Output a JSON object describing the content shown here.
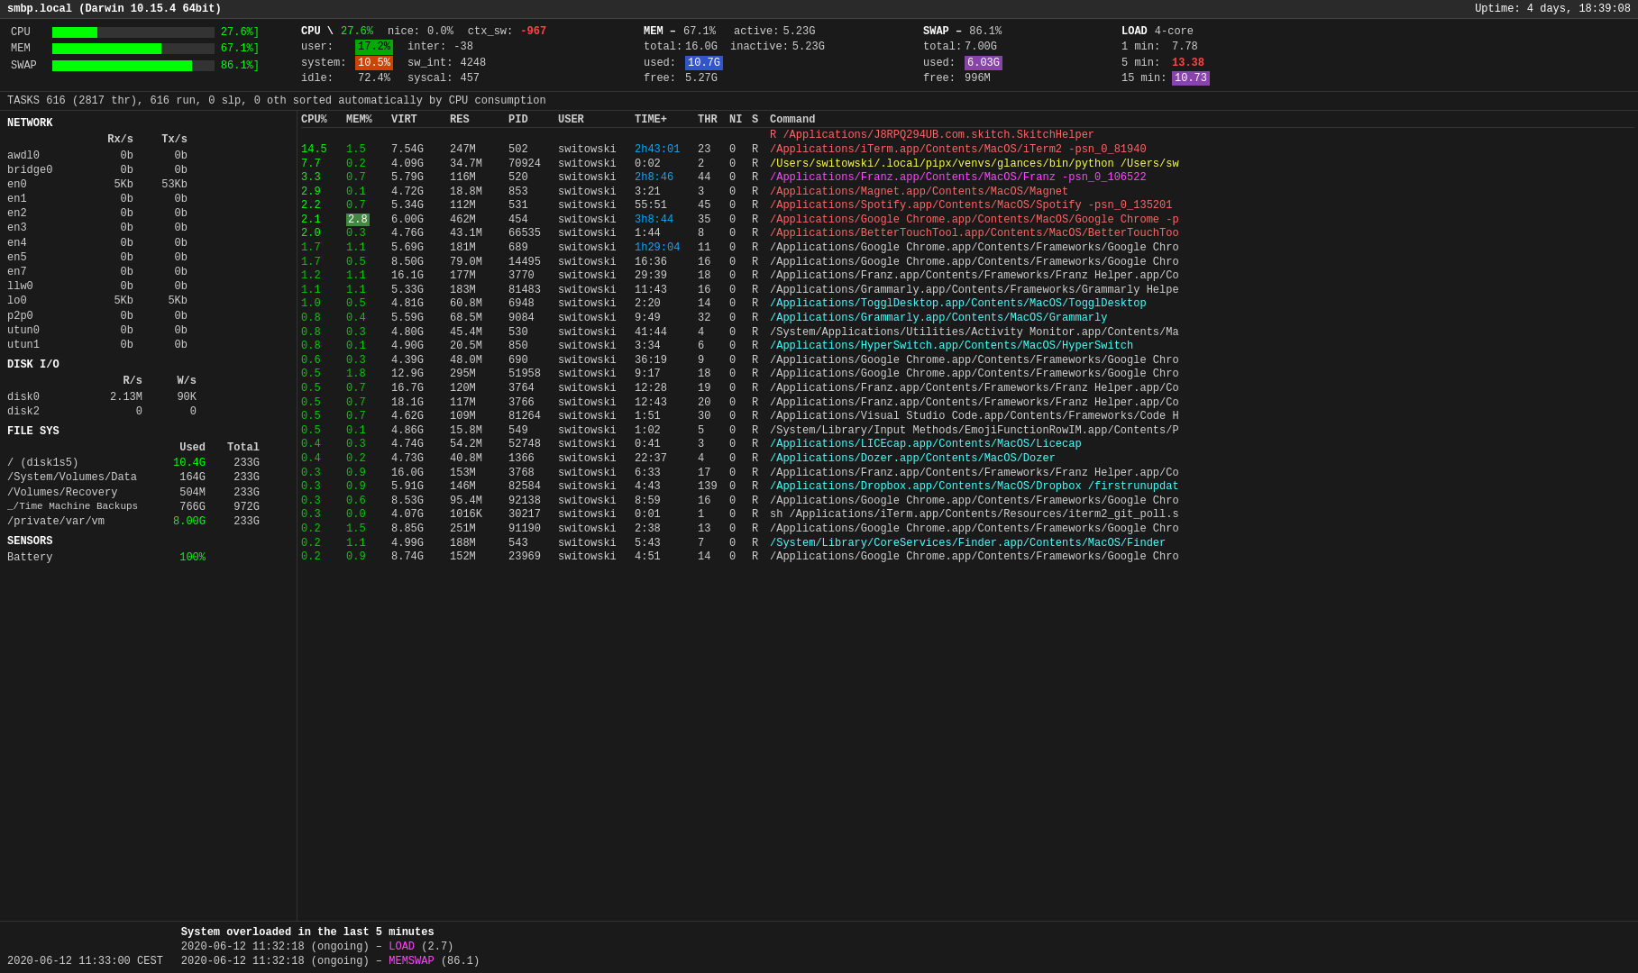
{
  "header": {
    "title": "smbp.local (Darwin 10.15.4 64bit)",
    "uptime": "Uptime: 4 days, 18:39:08"
  },
  "cpu_bars": [
    {
      "label": "CPU",
      "pct": "27.6%",
      "fill_pct": 27.6,
      "color": "#00ff00"
    },
    {
      "label": "MEM",
      "pct": "67.1%",
      "fill_pct": 67.1,
      "color": "#00ff00"
    },
    {
      "label": "SWAP",
      "pct": "86.1%",
      "fill_pct": 86.1,
      "color": "#00ff00"
    }
  ],
  "cpu_stats": {
    "title": "CPU",
    "pct": "27.6%",
    "user_label": "user:",
    "user_val": "17.2%",
    "system_label": "system:",
    "system_val": "10.5%",
    "idle_label": "idle:",
    "idle_val": "72.4%",
    "nice_label": "nice:",
    "nice_val": "0.0%",
    "inter_label": "inter:",
    "inter_val": "-38",
    "sw_int_label": "sw_int:",
    "sw_int_val": "4248",
    "syscal_label": "syscal:",
    "syscal_val": "457",
    "ctx_sw_label": "ctx_sw:",
    "ctx_sw_val": "-967"
  },
  "mem_stats": {
    "title": "MEM",
    "pct": "67.1%",
    "total_label": "total:",
    "total_val": "16.0G",
    "used_label": "used:",
    "used_val": "10.7G",
    "free_label": "free:",
    "free_val": "5.27G",
    "active_label": "active:",
    "active_val": "5.23G",
    "inactive_label": "inactive:",
    "inactive_val": "5.23G"
  },
  "swap_stats": {
    "title": "SWAP",
    "pct": "86.1%",
    "total_label": "total:",
    "total_val": "7.00G",
    "used_label": "used:",
    "used_val": "6.03G",
    "free_label": "free:",
    "free_val": "996M"
  },
  "load_stats": {
    "title": "LOAD",
    "cores": "4-core",
    "min1_label": "1 min:",
    "min1_val": "7.78",
    "min5_label": "5 min:",
    "min5_val": "13.38",
    "min15_label": "15 min:",
    "min15_val": "10.73"
  },
  "tasks": "TASKS 616 (2817 thr), 616 run, 0 slp, 0 oth sorted automatically by CPU consumption",
  "network": {
    "title": "NETWORK",
    "rx_header": "Rx/s",
    "tx_header": "Tx/s",
    "rows": [
      {
        "name": "awdl0",
        "rx": "0b",
        "tx": "0b"
      },
      {
        "name": "bridge0",
        "rx": "0b",
        "tx": "0b"
      },
      {
        "name": "en0",
        "rx": "5Kb",
        "tx": "53Kb"
      },
      {
        "name": "en1",
        "rx": "0b",
        "tx": "0b"
      },
      {
        "name": "en2",
        "rx": "0b",
        "tx": "0b"
      },
      {
        "name": "en3",
        "rx": "0b",
        "tx": "0b"
      },
      {
        "name": "en4",
        "rx": "0b",
        "tx": "0b"
      },
      {
        "name": "en5",
        "rx": "0b",
        "tx": "0b"
      },
      {
        "name": "en7",
        "rx": "0b",
        "tx": "0b"
      },
      {
        "name": "llw0",
        "rx": "0b",
        "tx": "0b"
      },
      {
        "name": "lo0",
        "rx": "5Kb",
        "tx": "5Kb"
      },
      {
        "name": "p2p0",
        "rx": "0b",
        "tx": "0b"
      },
      {
        "name": "utun0",
        "rx": "0b",
        "tx": "0b"
      },
      {
        "name": "utun1",
        "rx": "0b",
        "tx": "0b"
      }
    ]
  },
  "disk_io": {
    "title": "DISK I/O",
    "rs_header": "R/s",
    "ws_header": "W/s",
    "rows": [
      {
        "name": "disk0",
        "rs": "2.13M",
        "ws": "90K"
      },
      {
        "name": "disk2",
        "rs": "0",
        "ws": "0"
      }
    ]
  },
  "file_sys": {
    "title": "FILE SYS",
    "used_header": "Used",
    "total_header": "Total",
    "rows": [
      {
        "name": "/ (disk1s5)",
        "used": "10.4G",
        "total": "233G",
        "used_color": "green"
      },
      {
        "name": "/System/Volumes/Data",
        "used": "164G",
        "total": "233G",
        "used_color": "normal"
      },
      {
        "name": "/Volumes/Recovery",
        "used": "504M",
        "total": "233G",
        "used_color": "normal"
      },
      {
        "name": "_/Time Machine Backups",
        "used": "766G",
        "total": "972G",
        "used_color": "normal"
      },
      {
        "name": "/private/var/vm",
        "used": "8.00G",
        "total": "233G",
        "used_color": "green"
      }
    ]
  },
  "sensors": {
    "title": "SENSORS",
    "rows": [
      {
        "name": "Battery",
        "val": "100%"
      }
    ]
  },
  "processes": {
    "headers": [
      "CPU%",
      "MEM%",
      "VIRT",
      "RES",
      "PID",
      "USER",
      "TIME+",
      "THR",
      "NI",
      "S",
      "Command"
    ],
    "rows": [
      {
        "cpu": "",
        "mem": "",
        "virt": "",
        "res": "",
        "pid": "",
        "user": "",
        "time": "",
        "thr": "",
        "ni": "",
        "s": "",
        "cmd": "R /Applications/J8RPQ294UB.com.skitch.SkitchHelper",
        "cmd_color": "red"
      },
      {
        "cpu": "14.5",
        "mem": "1.5",
        "virt": "7.54G",
        "res": "247M",
        "pid": "502",
        "user": "switowski",
        "time": "2h43:01",
        "thr": "23",
        "ni": "0",
        "s": "R",
        "cmd": "/Applications/iTerm.app/Contents/MacOS/iTerm2 -psn_0_81940",
        "cmd_color": "red"
      },
      {
        "cpu": "7.7",
        "mem": "0.2",
        "virt": "4.09G",
        "res": "34.7M",
        "pid": "70924",
        "user": "switowski",
        "time": "0:02",
        "thr": "2",
        "ni": "0",
        "s": "R",
        "cmd": "/Users/switowski/.local/pipx/venvs/glances/bin/python /Users/sw",
        "cmd_color": "yellow"
      },
      {
        "cpu": "3.3",
        "mem": "0.7",
        "virt": "5.79G",
        "res": "116M",
        "pid": "520",
        "user": "switowski",
        "time": "2h8:46",
        "thr": "44",
        "ni": "0",
        "s": "R",
        "cmd": "/Applications/Franz.app/Contents/MacOS/Franz -psn_0_106522",
        "cmd_color": "magenta"
      },
      {
        "cpu": "2.9",
        "mem": "0.1",
        "virt": "4.72G",
        "res": "18.8M",
        "pid": "853",
        "user": "switowski",
        "time": "3:21",
        "thr": "3",
        "ni": "0",
        "s": "R",
        "cmd": "/Applications/Magnet.app/Contents/MacOS/Magnet",
        "cmd_color": "red"
      },
      {
        "cpu": "2.2",
        "mem": "0.7",
        "virt": "5.34G",
        "res": "112M",
        "pid": "531",
        "user": "switowski",
        "time": "55:51",
        "thr": "45",
        "ni": "0",
        "s": "R",
        "cmd": "/Applications/Spotify.app/Contents/MacOS/Spotify -psn_0_135201",
        "cmd_color": "red"
      },
      {
        "cpu": "2.1",
        "mem": "2.8",
        "virt": "6.00G",
        "res": "462M",
        "pid": "454",
        "user": "switowski",
        "time": "3h8:44",
        "thr": "35",
        "ni": "0",
        "s": "R",
        "cmd": "/Applications/Google Chrome.app/Contents/MacOS/Google Chrome -p",
        "cmd_color": "red"
      },
      {
        "cpu": "2.0",
        "mem": "0.3",
        "virt": "4.76G",
        "res": "43.1M",
        "pid": "66535",
        "user": "switowski",
        "time": "1:44",
        "thr": "8",
        "ni": "0",
        "s": "R",
        "cmd": "/Applications/BetterTouchTool.app/Contents/MacOS/BetterTouchToo",
        "cmd_color": "red"
      },
      {
        "cpu": "1.7",
        "mem": "1.1",
        "virt": "5.69G",
        "res": "181M",
        "pid": "689",
        "user": "switowski",
        "time": "1h29:04",
        "thr": "11",
        "ni": "0",
        "s": "R",
        "cmd": "/Applications/Google Chrome.app/Contents/Frameworks/Google Chro",
        "cmd_color": "normal"
      },
      {
        "cpu": "1.7",
        "mem": "0.5",
        "virt": "8.50G",
        "res": "79.0M",
        "pid": "14495",
        "user": "switowski",
        "time": "16:36",
        "thr": "16",
        "ni": "0",
        "s": "R",
        "cmd": "/Applications/Google Chrome.app/Contents/Frameworks/Google Chro",
        "cmd_color": "normal"
      },
      {
        "cpu": "1.2",
        "mem": "1.1",
        "virt": "16.1G",
        "res": "177M",
        "pid": "3770",
        "user": "switowski",
        "time": "29:39",
        "thr": "18",
        "ni": "0",
        "s": "R",
        "cmd": "/Applications/Franz.app/Contents/Frameworks/Franz Helper.app/Co",
        "cmd_color": "normal"
      },
      {
        "cpu": "1.1",
        "mem": "1.1",
        "virt": "5.33G",
        "res": "183M",
        "pid": "81483",
        "user": "switowski",
        "time": "11:43",
        "thr": "16",
        "ni": "0",
        "s": "R",
        "cmd": "/Applications/Grammarly.app/Contents/Frameworks/Grammarly Helpe",
        "cmd_color": "normal"
      },
      {
        "cpu": "1.0",
        "mem": "0.5",
        "virt": "4.81G",
        "res": "60.8M",
        "pid": "6948",
        "user": "switowski",
        "time": "2:20",
        "thr": "14",
        "ni": "0",
        "s": "R",
        "cmd": "/Applications/TogglDesktop.app/Contents/MacOS/TogglDesktop",
        "cmd_color": "cyan"
      },
      {
        "cpu": "0.8",
        "mem": "0.4",
        "virt": "5.59G",
        "res": "68.5M",
        "pid": "9084",
        "user": "switowski",
        "time": "9:49",
        "thr": "32",
        "ni": "0",
        "s": "R",
        "cmd": "/Applications/Grammarly.app/Contents/MacOS/Grammarly",
        "cmd_color": "cyan"
      },
      {
        "cpu": "0.8",
        "mem": "0.3",
        "virt": "4.80G",
        "res": "45.4M",
        "pid": "530",
        "user": "switowski",
        "time": "41:44",
        "thr": "4",
        "ni": "0",
        "s": "R",
        "cmd": "/System/Applications/Utilities/Activity Monitor.app/Contents/Ma",
        "cmd_color": "normal"
      },
      {
        "cpu": "0.8",
        "mem": "0.1",
        "virt": "4.90G",
        "res": "20.5M",
        "pid": "850",
        "user": "switowski",
        "time": "3:34",
        "thr": "6",
        "ni": "0",
        "s": "R",
        "cmd": "/Applications/HyperSwitch.app/Contents/MacOS/HyperSwitch",
        "cmd_color": "cyan"
      },
      {
        "cpu": "0.6",
        "mem": "0.3",
        "virt": "4.39G",
        "res": "48.0M",
        "pid": "690",
        "user": "switowski",
        "time": "36:19",
        "thr": "9",
        "ni": "0",
        "s": "R",
        "cmd": "/Applications/Google Chrome.app/Contents/Frameworks/Google Chro",
        "cmd_color": "normal"
      },
      {
        "cpu": "0.5",
        "mem": "1.8",
        "virt": "12.9G",
        "res": "295M",
        "pid": "51958",
        "user": "switowski",
        "time": "9:17",
        "thr": "18",
        "ni": "0",
        "s": "R",
        "cmd": "/Applications/Google Chrome.app/Contents/Frameworks/Google Chro",
        "cmd_color": "normal"
      },
      {
        "cpu": "0.5",
        "mem": "0.7",
        "virt": "16.7G",
        "res": "120M",
        "pid": "3764",
        "user": "switowski",
        "time": "12:28",
        "thr": "19",
        "ni": "0",
        "s": "R",
        "cmd": "/Applications/Franz.app/Contents/Frameworks/Franz Helper.app/Co",
        "cmd_color": "normal"
      },
      {
        "cpu": "0.5",
        "mem": "0.7",
        "virt": "18.1G",
        "res": "117M",
        "pid": "3766",
        "user": "switowski",
        "time": "12:43",
        "thr": "20",
        "ni": "0",
        "s": "R",
        "cmd": "/Applications/Franz.app/Contents/Frameworks/Franz Helper.app/Co",
        "cmd_color": "normal"
      },
      {
        "cpu": "0.5",
        "mem": "0.7",
        "virt": "4.62G",
        "res": "109M",
        "pid": "81264",
        "user": "switowski",
        "time": "1:51",
        "thr": "30",
        "ni": "0",
        "s": "R",
        "cmd": "/Applications/Visual Studio Code.app/Contents/Frameworks/Code H",
        "cmd_color": "normal"
      },
      {
        "cpu": "0.5",
        "mem": "0.1",
        "virt": "4.86G",
        "res": "15.8M",
        "pid": "549",
        "user": "switowski",
        "time": "1:02",
        "thr": "5",
        "ni": "0",
        "s": "R",
        "cmd": "/System/Library/Input Methods/EmojiFunctionRowIM.app/Contents/P",
        "cmd_color": "normal"
      },
      {
        "cpu": "0.4",
        "mem": "0.3",
        "virt": "4.74G",
        "res": "54.2M",
        "pid": "52748",
        "user": "switowski",
        "time": "0:41",
        "thr": "3",
        "ni": "0",
        "s": "R",
        "cmd": "/Applications/LICEcap.app/Contents/MacOS/Licecap",
        "cmd_color": "cyan"
      },
      {
        "cpu": "0.4",
        "mem": "0.2",
        "virt": "4.73G",
        "res": "40.8M",
        "pid": "1366",
        "user": "switowski",
        "time": "22:37",
        "thr": "4",
        "ni": "0",
        "s": "R",
        "cmd": "/Applications/Dozer.app/Contents/MacOS/Dozer",
        "cmd_color": "cyan"
      },
      {
        "cpu": "0.3",
        "mem": "0.9",
        "virt": "16.0G",
        "res": "153M",
        "pid": "3768",
        "user": "switowski",
        "time": "6:33",
        "thr": "17",
        "ni": "0",
        "s": "R",
        "cmd": "/Applications/Franz.app/Contents/Frameworks/Franz Helper.app/Co",
        "cmd_color": "normal"
      },
      {
        "cpu": "0.3",
        "mem": "0.9",
        "virt": "5.91G",
        "res": "146M",
        "pid": "82584",
        "user": "switowski",
        "time": "4:43",
        "thr": "139",
        "ni": "0",
        "s": "R",
        "cmd": "/Applications/Dropbox.app/Contents/MacOS/Dropbox /firstrunupdat",
        "cmd_color": "cyan"
      },
      {
        "cpu": "0.3",
        "mem": "0.6",
        "virt": "8.53G",
        "res": "95.4M",
        "pid": "92138",
        "user": "switowski",
        "time": "8:59",
        "thr": "16",
        "ni": "0",
        "s": "R",
        "cmd": "/Applications/Google Chrome.app/Contents/Frameworks/Google Chro",
        "cmd_color": "normal"
      },
      {
        "cpu": "0.3",
        "mem": "0.0",
        "virt": "4.07G",
        "res": "1016K",
        "pid": "30217",
        "user": "switowski",
        "time": "0:01",
        "thr": "1",
        "ni": "0",
        "s": "R",
        "cmd": "sh /Applications/iTerm.app/Contents/Resources/iterm2_git_poll.s",
        "cmd_color": "normal"
      },
      {
        "cpu": "0.2",
        "mem": "1.5",
        "virt": "8.85G",
        "res": "251M",
        "pid": "91190",
        "user": "switowski",
        "time": "2:38",
        "thr": "13",
        "ni": "0",
        "s": "R",
        "cmd": "/Applications/Google Chrome.app/Contents/Frameworks/Google Chro",
        "cmd_color": "normal"
      },
      {
        "cpu": "0.2",
        "mem": "1.1",
        "virt": "4.99G",
        "res": "188M",
        "pid": "543",
        "user": "switowski",
        "time": "5:43",
        "thr": "7",
        "ni": "0",
        "s": "R",
        "cmd": "/System/Library/CoreServices/Finder.app/Contents/MacOS/Finder",
        "cmd_color": "cyan"
      },
      {
        "cpu": "0.2",
        "mem": "0.9",
        "virt": "8.74G",
        "res": "152M",
        "pid": "23969",
        "user": "switowski",
        "time": "4:51",
        "thr": "14",
        "ni": "0",
        "s": "R",
        "cmd": "/Applications/Google Chrome.app/Contents/Frameworks/Google Chro",
        "cmd_color": "normal"
      }
    ]
  },
  "alerts": {
    "title": "System overloaded in the last 5 minutes",
    "lines": [
      {
        "text": "2020-06-12 11:32:18 (ongoing) – LOAD (2.7)",
        "highlight": "LOAD"
      },
      {
        "text": "2020-06-12 11:32:18 (ongoing) – MEMSWAP (86.1)",
        "highlight": "MEMSWAP"
      }
    ]
  },
  "footer": {
    "datetime": "2020-06-12 11:33:00 CEST"
  }
}
